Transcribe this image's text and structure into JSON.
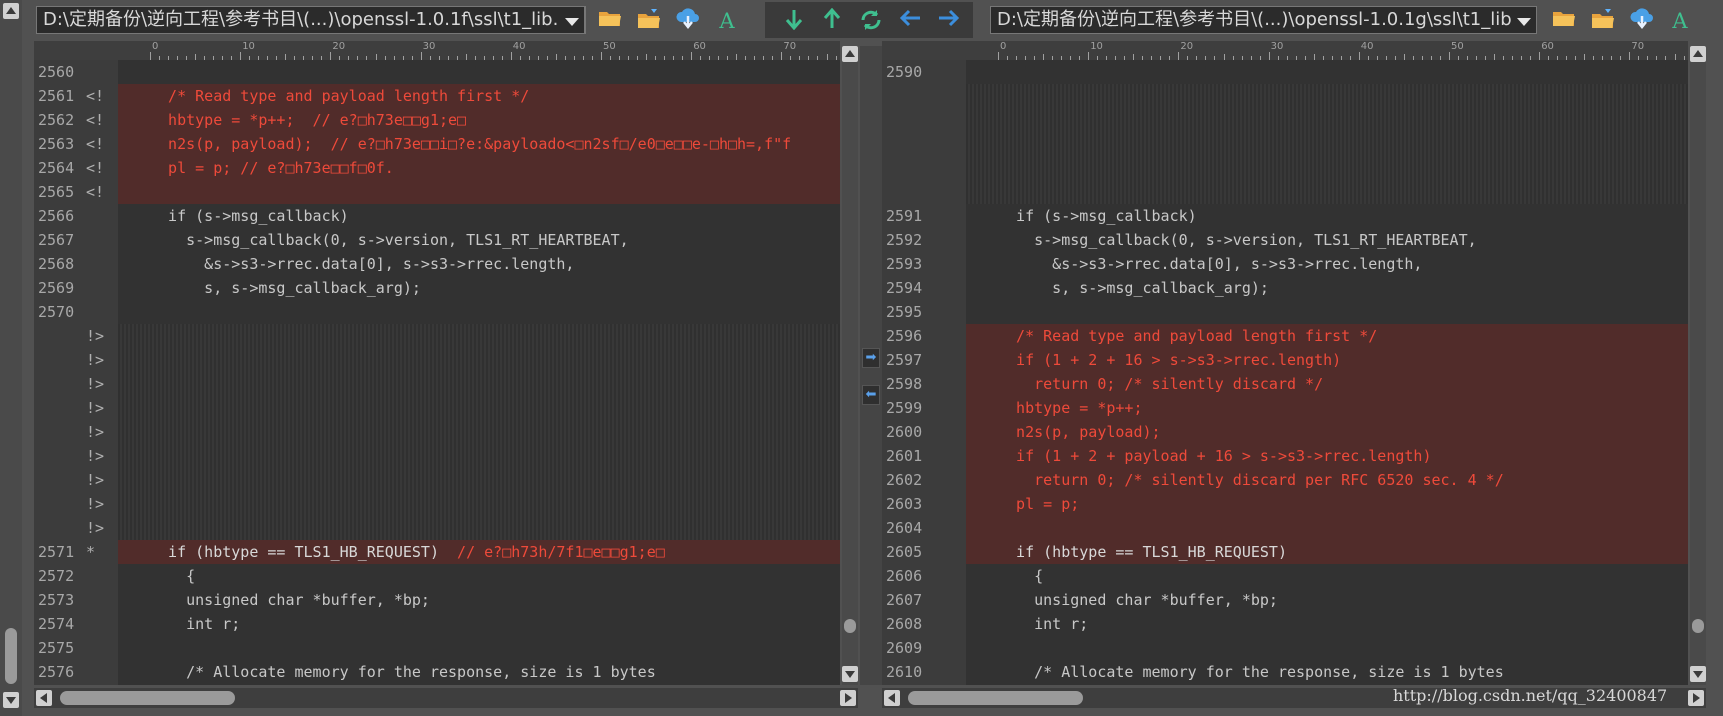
{
  "left": {
    "path": "D:\\定期备份\\逆向工程\\参考书目\\(...)\\openssl-1.0.1f\\ssl\\t1_lib.c",
    "ruler_ticks": [
      "0",
      "10",
      "20",
      "30",
      "40",
      "50",
      "60",
      "70"
    ],
    "lines": [
      {
        "ln": "2560",
        "mk": "",
        "code": "",
        "type": "normal"
      },
      {
        "ln": "2561",
        "mk": "<!",
        "code": "  /* Read type and payload length first */",
        "type": "del"
      },
      {
        "ln": "2562",
        "mk": "<!",
        "code": "  hbtype = *p++;  // e?□h73e□□g1;e□",
        "type": "del"
      },
      {
        "ln": "2563",
        "mk": "<!",
        "code": "  n2s(p, payload);  // e?□h73e□□i□?e:&payloado<□n2sf□/e0□e□□e-□h□h=,f\"f",
        "type": "del"
      },
      {
        "ln": "2564",
        "mk": "<!",
        "code": "  pl = p; // e?□h73e□□f□0f.",
        "type": "del"
      },
      {
        "ln": "2565",
        "mk": "<!",
        "code": "",
        "type": "del"
      },
      {
        "ln": "2566",
        "mk": "",
        "code": "  if (s->msg_callback)",
        "type": "normal"
      },
      {
        "ln": "2567",
        "mk": "",
        "code": "    s->msg_callback(0, s->version, TLS1_RT_HEARTBEAT,",
        "type": "normal"
      },
      {
        "ln": "2568",
        "mk": "",
        "code": "      &s->s3->rrec.data[0], s->s3->rrec.length,",
        "type": "normal"
      },
      {
        "ln": "2569",
        "mk": "",
        "code": "      s, s->msg_callback_arg);",
        "type": "normal"
      },
      {
        "ln": "2570",
        "mk": "",
        "code": "",
        "type": "normal"
      },
      {
        "ln": "",
        "mk": "!>",
        "code": "",
        "type": "blank"
      },
      {
        "ln": "",
        "mk": "!>",
        "code": "",
        "type": "blank"
      },
      {
        "ln": "",
        "mk": "!>",
        "code": "",
        "type": "blank"
      },
      {
        "ln": "",
        "mk": "!>",
        "code": "",
        "type": "blank"
      },
      {
        "ln": "",
        "mk": "!>",
        "code": "",
        "type": "blank"
      },
      {
        "ln": "",
        "mk": "!>",
        "code": "",
        "type": "blank"
      },
      {
        "ln": "",
        "mk": "!>",
        "code": "",
        "type": "blank"
      },
      {
        "ln": "",
        "mk": "!>",
        "code": "",
        "type": "blank"
      },
      {
        "ln": "",
        "mk": "!>",
        "code": "",
        "type": "blank"
      },
      {
        "ln": "2571",
        "mk": "*",
        "code": "  if (hbtype == TLS1_HB_REQUEST)  // e?□h73h/7f1□e□□g1;e□",
        "type": "change"
      },
      {
        "ln": "2572",
        "mk": "",
        "code": "    {",
        "type": "normal"
      },
      {
        "ln": "2573",
        "mk": "",
        "code": "    unsigned char *buffer, *bp;",
        "type": "normal"
      },
      {
        "ln": "2574",
        "mk": "",
        "code": "    int r;",
        "type": "normal"
      },
      {
        "ln": "2575",
        "mk": "",
        "code": "",
        "type": "normal"
      },
      {
        "ln": "2576",
        "mk": "",
        "code": "    /* Allocate memory for the response, size is 1 bytes",
        "type": "normal"
      }
    ]
  },
  "right": {
    "path": "D:\\定期备份\\逆向工程\\参考书目\\(...)\\openssl-1.0.1g\\ssl\\t1_lib.c",
    "ruler_ticks": [
      "0",
      "10",
      "20",
      "30",
      "40",
      "50",
      "60",
      "70"
    ],
    "lines": [
      {
        "ln": "2590",
        "mk": "",
        "code": "",
        "type": "normal"
      },
      {
        "ln": "",
        "mk": "",
        "code": "",
        "type": "blank"
      },
      {
        "ln": "",
        "mk": "",
        "code": "",
        "type": "blank"
      },
      {
        "ln": "",
        "mk": "",
        "code": "",
        "type": "blank"
      },
      {
        "ln": "",
        "mk": "",
        "code": "",
        "type": "blank"
      },
      {
        "ln": "",
        "mk": "",
        "code": "",
        "type": "blank"
      },
      {
        "ln": "2591",
        "mk": "",
        "code": "  if (s->msg_callback)",
        "type": "normal"
      },
      {
        "ln": "2592",
        "mk": "",
        "code": "    s->msg_callback(0, s->version, TLS1_RT_HEARTBEAT,",
        "type": "normal"
      },
      {
        "ln": "2593",
        "mk": "",
        "code": "      &s->s3->rrec.data[0], s->s3->rrec.length,",
        "type": "normal"
      },
      {
        "ln": "2594",
        "mk": "",
        "code": "      s, s->msg_callback_arg);",
        "type": "normal"
      },
      {
        "ln": "2595",
        "mk": "",
        "code": "",
        "type": "normal"
      },
      {
        "ln": "2596",
        "mk": "",
        "code": "  /* Read type and payload length first */",
        "type": "del"
      },
      {
        "ln": "2597",
        "mk": "",
        "code": "  if (1 + 2 + 16 > s->s3->rrec.length)",
        "type": "del"
      },
      {
        "ln": "2598",
        "mk": "",
        "code": "    return 0; /* silently discard */",
        "type": "del"
      },
      {
        "ln": "2599",
        "mk": "",
        "code": "  hbtype = *p++;",
        "type": "del"
      },
      {
        "ln": "2600",
        "mk": "",
        "code": "  n2s(p, payload);",
        "type": "del"
      },
      {
        "ln": "2601",
        "mk": "",
        "code": "  if (1 + 2 + payload + 16 > s->s3->rrec.length)",
        "type": "del"
      },
      {
        "ln": "2602",
        "mk": "",
        "code": "    return 0; /* silently discard per RFC 6520 sec. 4 */",
        "type": "del"
      },
      {
        "ln": "2603",
        "mk": "",
        "code": "  pl = p;",
        "type": "del"
      },
      {
        "ln": "2604",
        "mk": "",
        "code": "",
        "type": "del"
      },
      {
        "ln": "2605",
        "mk": "",
        "code": "  if (hbtype == TLS1_HB_REQUEST)",
        "type": "changeR"
      },
      {
        "ln": "2606",
        "mk": "",
        "code": "    {",
        "type": "normal"
      },
      {
        "ln": "2607",
        "mk": "",
        "code": "    unsigned char *buffer, *bp;",
        "type": "normal"
      },
      {
        "ln": "2608",
        "mk": "",
        "code": "    int r;",
        "type": "normal"
      },
      {
        "ln": "2609",
        "mk": "",
        "code": "",
        "type": "normal"
      },
      {
        "ln": "2610",
        "mk": "",
        "code": "    /* Allocate memory for the response, size is 1 bytes",
        "type": "normal"
      }
    ]
  },
  "toolbar": {
    "font_glyph": "A"
  },
  "watermark": "http://blog.csdn.net/qq_32400847",
  "colors": {
    "deleted_text": "#ee4a3a",
    "deleted_bg": "#512c2a",
    "toolbar_green": "#3fbf8f",
    "toolbar_blue": "#3c8edc"
  }
}
